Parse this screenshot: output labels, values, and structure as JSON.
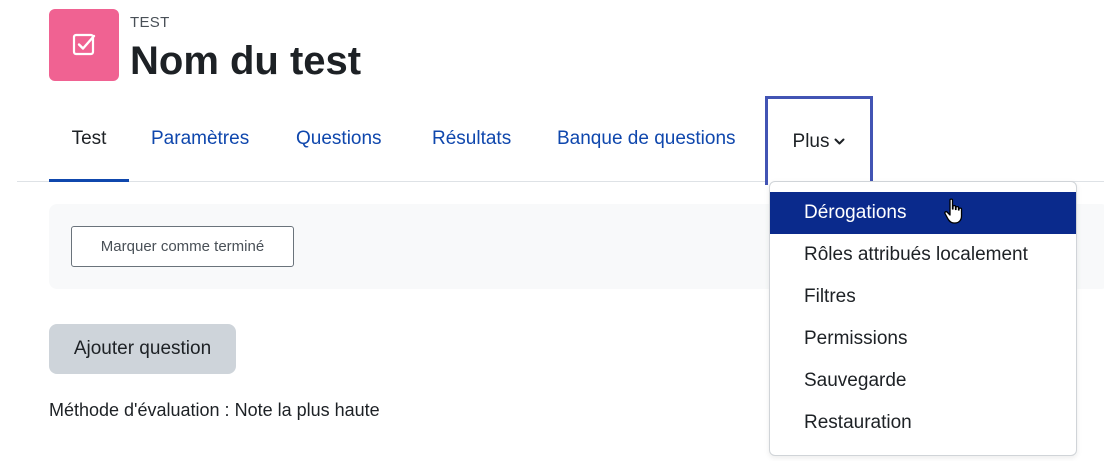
{
  "header": {
    "activity_label": "TEST",
    "title": "Nom du test",
    "icon": "quiz-checkbox-icon",
    "icon_color": "#f06292"
  },
  "tabs": [
    {
      "label": "Test",
      "active": true
    },
    {
      "label": "Paramètres"
    },
    {
      "label": "Questions"
    },
    {
      "label": "Résultats"
    },
    {
      "label": "Banque de questions"
    },
    {
      "label": "Plus",
      "open": true
    }
  ],
  "completion": {
    "button_label": "Marquer comme terminé"
  },
  "actions": {
    "add_question_label": "Ajouter question"
  },
  "grading_method": "Méthode d'évaluation : Note la plus haute",
  "dropdown": {
    "items": [
      {
        "label": "Dérogations",
        "highlighted": true
      },
      {
        "label": "Rôles attribués localement"
      },
      {
        "label": "Filtres"
      },
      {
        "label": "Permissions"
      },
      {
        "label": "Sauvegarde"
      },
      {
        "label": "Restauration"
      }
    ]
  },
  "colors": {
    "link": "#0f47ad",
    "highlight": "#0a2a8c",
    "focus_outline": "#4254b4"
  }
}
